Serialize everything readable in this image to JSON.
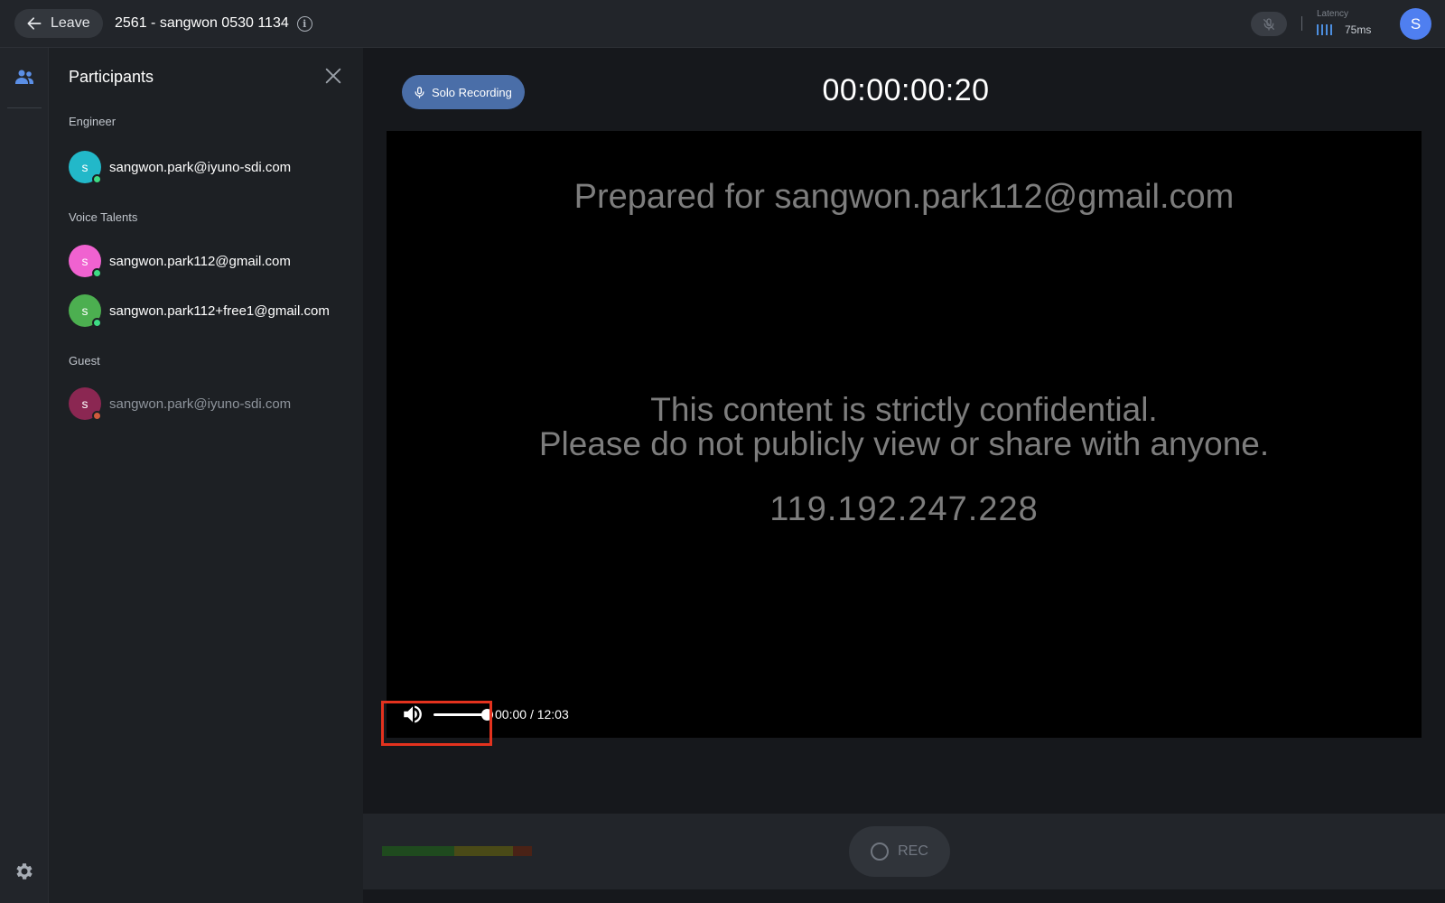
{
  "topbar": {
    "leave_label": "Leave",
    "session_title": "2561 - sangwon 0530 1134",
    "latency_label": "Latency",
    "latency_value": "75ms",
    "user_initial": "S"
  },
  "participants": {
    "title": "Participants",
    "groups": [
      {
        "label": "Engineer",
        "members": [
          {
            "initial": "s",
            "name": "sangwon.park@iyuno-sdi.com",
            "avatar_color": "#22b8c9",
            "status": "online",
            "status_color": "#3ddc84"
          }
        ]
      },
      {
        "label": "Voice Talents",
        "members": [
          {
            "initial": "s",
            "name": "sangwon.park112@gmail.com",
            "avatar_color": "#f062d0",
            "status": "online",
            "status_color": "#3ddc84"
          },
          {
            "initial": "s",
            "name": "sangwon.park112+free1@gmail.com",
            "avatar_color": "#4caf50",
            "status": "online",
            "status_color": "#3ddc84"
          }
        ]
      },
      {
        "label": "Guest",
        "members": [
          {
            "initial": "s",
            "name": "sangwon.park@iyuno-sdi.com",
            "avatar_color": "#8b2752",
            "status": "offline",
            "status_color": "#d05a3c"
          }
        ]
      }
    ]
  },
  "main": {
    "solo_recording_label": "Solo Recording",
    "timer": "00:00:00:20",
    "watermark": {
      "line1": "Prepared for sangwon.park112@gmail.com",
      "line2": "This content is strictly confidential.",
      "line3": "Please do not publicly view or share with anyone.",
      "line4": "119.192.247.228"
    },
    "player": {
      "current_time": "00:00",
      "separator": "/",
      "duration": "12:03",
      "volume": 1.0
    }
  },
  "bottombar": {
    "rec_label": "REC"
  },
  "colors": {
    "accent": "#4a6ea8",
    "highlight": "#e3321e",
    "latency_bars": "#4d8fe0"
  }
}
